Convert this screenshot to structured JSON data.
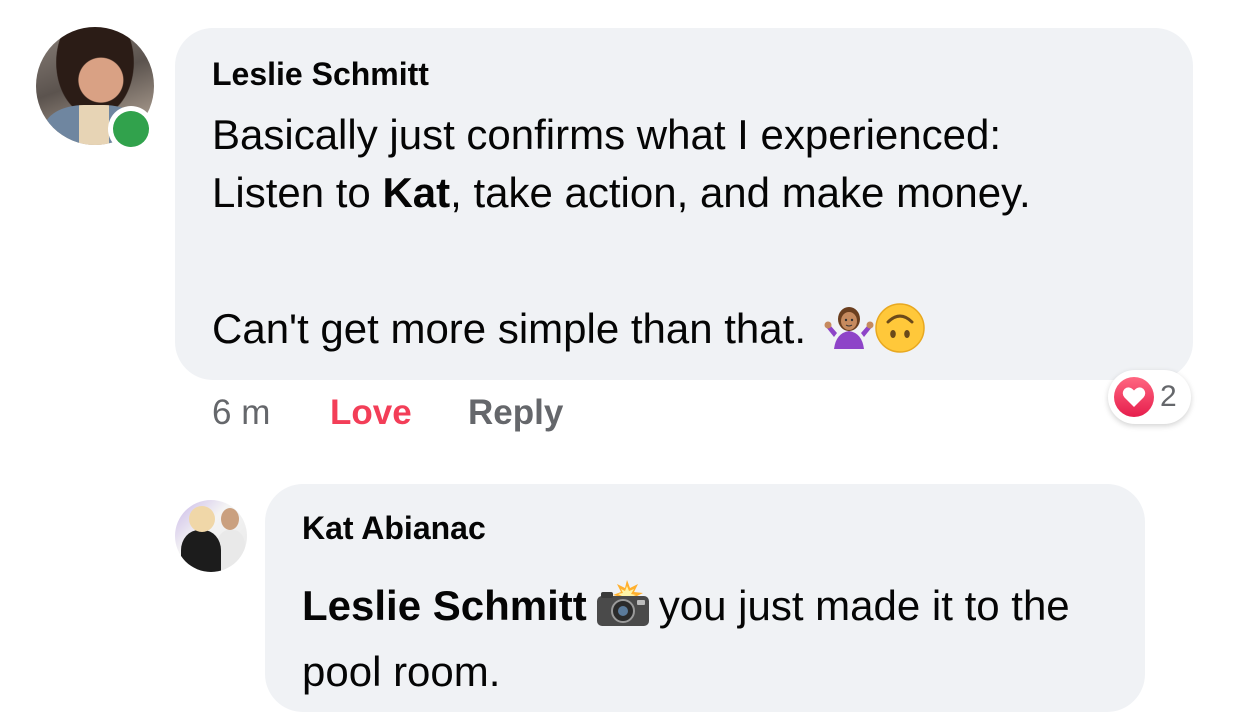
{
  "comment": {
    "author": "Leslie Schmitt",
    "line1": "Basically just confirms what I experienced:",
    "line2_prefix": "Listen to ",
    "line2_mention": "Kat",
    "line2_suffix": ", take action, and make money.",
    "line3": "Can't get more simple than that.",
    "emojis": [
      "woman-shrugging-icon",
      "upside-down-face-icon"
    ],
    "time": "6 m",
    "love_label": "Love",
    "reply_label": "Reply",
    "reaction_icon": "heart-icon",
    "reaction_count": "2",
    "online_status_color": "#31a24c"
  },
  "reply": {
    "author": "Kat Abianac",
    "mention": "Leslie Schmitt",
    "emoji": "camera-flash-icon",
    "text": "you just made it to the pool room."
  },
  "colors": {
    "bubble": "#f0f2f5",
    "love": "#f33e58",
    "meta": "#65676b"
  }
}
